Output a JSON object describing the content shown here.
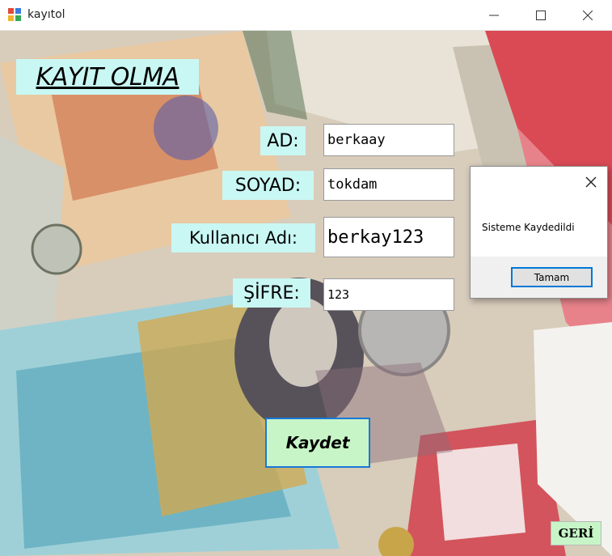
{
  "window": {
    "title": "kayıtol",
    "icon": "app-form-icon",
    "controls": [
      "minimize-icon",
      "maximize-icon",
      "close-icon"
    ]
  },
  "form": {
    "heading": "KAYIT OLMA",
    "fields": {
      "ad": {
        "label": "AD:",
        "value": "berkaay"
      },
      "soyad": {
        "label": "SOYAD:",
        "value": "tokdam"
      },
      "kullanici": {
        "label": "Kullanıcı Adı:",
        "value": "berkay123"
      },
      "sifre": {
        "label": "ŞİFRE:",
        "value": "123"
      }
    },
    "save_label": "Kaydet",
    "back_label": "GERİ"
  },
  "dialog": {
    "message": "Sisteme Kaydedildi",
    "ok_label": "Tamam"
  },
  "colors": {
    "label_bg": "#c9f7f3",
    "button_bg": "#c7f5c7",
    "accent": "#0078d7"
  }
}
